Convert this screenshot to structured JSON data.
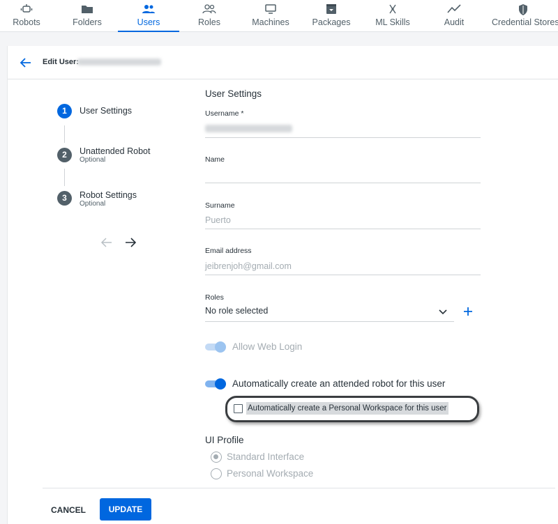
{
  "nav": {
    "tabs": [
      {
        "label": "Robots",
        "icon": "robot-icon"
      },
      {
        "label": "Folders",
        "icon": "folder-icon"
      },
      {
        "label": "Users",
        "icon": "users-icon",
        "active": true
      },
      {
        "label": "Roles",
        "icon": "roles-icon"
      },
      {
        "label": "Machines",
        "icon": "machine-icon"
      },
      {
        "label": "Packages",
        "icon": "package-icon"
      },
      {
        "label": "ML Skills",
        "icon": "ml-skills-icon"
      },
      {
        "label": "Audit",
        "icon": "audit-icon"
      },
      {
        "label": "Credential Stores",
        "icon": "credential-shield-icon"
      }
    ]
  },
  "header": {
    "edit_label": "Edit User:"
  },
  "stepper": {
    "steps": [
      {
        "number": "1",
        "title": "User Settings",
        "subtitle": "",
        "active": true
      },
      {
        "number": "2",
        "title": "Unattended Robot",
        "subtitle": "Optional"
      },
      {
        "number": "3",
        "title": "Robot Settings",
        "subtitle": "Optional"
      }
    ]
  },
  "form": {
    "section_title": "User Settings",
    "username": {
      "label": "Username *"
    },
    "name": {
      "label": "Name",
      "value": ""
    },
    "surname": {
      "label": "Surname",
      "value": "Puerto"
    },
    "email": {
      "label": "Email address",
      "value": "jeibrenjoh@gmail.com"
    },
    "roles": {
      "label": "Roles",
      "value": "No role selected"
    },
    "allow_web_login": {
      "label": "Allow Web Login",
      "on": true,
      "disabled": true
    },
    "auto_robot": {
      "label": "Automatically create an attended robot for this user",
      "on": true
    },
    "personal_workspace": {
      "label": "Automatically create a Personal Workspace for this user",
      "checked": false
    },
    "ui_profile": {
      "label": "UI Profile",
      "options": [
        {
          "label": "Standard Interface",
          "selected": true
        },
        {
          "label": "Personal Workspace",
          "selected": false
        }
      ]
    }
  },
  "footer": {
    "cancel_label": "CANCEL",
    "update_label": "UPDATE"
  },
  "colors": {
    "accent": "#0067df",
    "toggle_disabled": "#9cc4f0",
    "step_inactive": "#526069"
  }
}
